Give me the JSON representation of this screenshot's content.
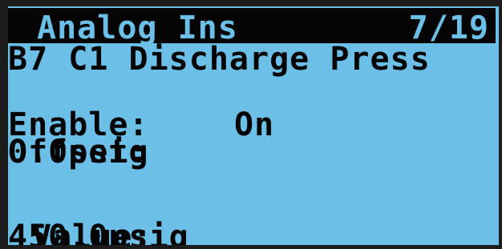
{
  "header": {
    "title": "Analog Ins",
    "page": "7/19"
  },
  "point": {
    "name": "B7 C1 Discharge Press"
  },
  "fields": {
    "enable_label": "Enable:",
    "enable_value": "On",
    "offset_label": "Offset:",
    "offset_value": "0.0psig",
    "value_label": "Value:",
    "value_value": "450.0psig"
  },
  "colors": {
    "lcd_background": "#6cbfe6",
    "lcd_text": "#050505",
    "bezel": "#1c1c1c"
  }
}
